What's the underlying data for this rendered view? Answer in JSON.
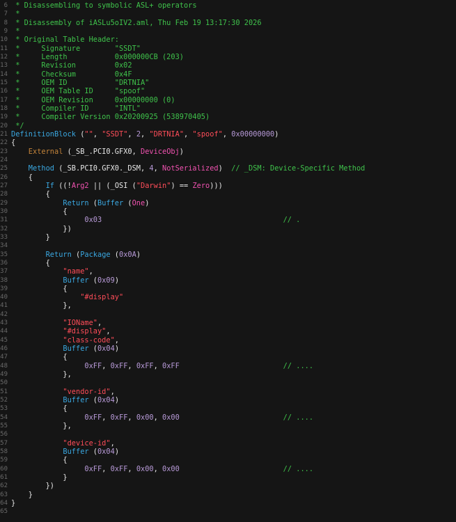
{
  "editor": {
    "colors": {
      "background": "#151515",
      "line_number": "#6a6a6a",
      "comment": "#3fc24b",
      "text": "#e8e8e8",
      "string": "#ff4d59",
      "keyword": "#3aa7e0",
      "number": "#b89ad8",
      "constant": "#f052b0",
      "external": "#c4843a"
    },
    "lines": [
      {
        "n": "6",
        "tokens": [
          {
            "t": "c",
            "v": " * Disassembling to symbolic ASL+ operators"
          }
        ]
      },
      {
        "n": "7",
        "tokens": [
          {
            "t": "c",
            "v": " *"
          }
        ]
      },
      {
        "n": "8",
        "tokens": [
          {
            "t": "c",
            "v": " * Disassembly of iASLu5oIV2.aml, Thu Feb 19 13:17:30 2026"
          }
        ]
      },
      {
        "n": "9",
        "tokens": [
          {
            "t": "c",
            "v": " *"
          }
        ]
      },
      {
        "n": "10",
        "tokens": [
          {
            "t": "c",
            "v": " * Original Table Header:"
          }
        ]
      },
      {
        "n": "11",
        "tokens": [
          {
            "t": "c",
            "v": " *     Signature        \"SSDT\""
          }
        ]
      },
      {
        "n": "12",
        "tokens": [
          {
            "t": "c",
            "v": " *     Length           0x000000CB (203)"
          }
        ]
      },
      {
        "n": "13",
        "tokens": [
          {
            "t": "c",
            "v": " *     Revision         0x02"
          }
        ]
      },
      {
        "n": "14",
        "tokens": [
          {
            "t": "c",
            "v": " *     Checksum         0x4F"
          }
        ]
      },
      {
        "n": "15",
        "tokens": [
          {
            "t": "c",
            "v": " *     OEM ID           \"DRTNIA\""
          }
        ]
      },
      {
        "n": "16",
        "tokens": [
          {
            "t": "c",
            "v": " *     OEM Table ID     \"spoof\""
          }
        ]
      },
      {
        "n": "17",
        "tokens": [
          {
            "t": "c",
            "v": " *     OEM Revision     0x00000000 (0)"
          }
        ]
      },
      {
        "n": "18",
        "tokens": [
          {
            "t": "c",
            "v": " *     Compiler ID      \"INTL\""
          }
        ]
      },
      {
        "n": "19",
        "tokens": [
          {
            "t": "c",
            "v": " *     Compiler Version 0x20200925 (538970405)"
          }
        ]
      },
      {
        "n": "20",
        "tokens": [
          {
            "t": "c",
            "v": " */"
          }
        ]
      },
      {
        "n": "21",
        "tokens": [
          {
            "t": "k",
            "v": "DefinitionBlock"
          },
          {
            "t": "t",
            "v": " ("
          },
          {
            "t": "s",
            "v": "\"\""
          },
          {
            "t": "t",
            "v": ", "
          },
          {
            "t": "s",
            "v": "\"SSDT\""
          },
          {
            "t": "t",
            "v": ", "
          },
          {
            "t": "n",
            "v": "2"
          },
          {
            "t": "t",
            "v": ", "
          },
          {
            "t": "s",
            "v": "\"DRTNIA\""
          },
          {
            "t": "t",
            "v": ", "
          },
          {
            "t": "s",
            "v": "\"spoof\""
          },
          {
            "t": "t",
            "v": ", "
          },
          {
            "t": "n",
            "v": "0x00000000"
          },
          {
            "t": "t",
            "v": ")"
          }
        ]
      },
      {
        "n": "22",
        "tokens": [
          {
            "t": "t",
            "v": "{"
          }
        ]
      },
      {
        "n": "23",
        "tokens": [
          {
            "t": "a",
            "v": "    External"
          },
          {
            "t": "t",
            "v": " (_SB_.PCI0.GFX0, "
          },
          {
            "t": "m",
            "v": "DeviceObj"
          },
          {
            "t": "t",
            "v": ")"
          }
        ]
      },
      {
        "n": "24",
        "tokens": []
      },
      {
        "n": "25",
        "tokens": [
          {
            "t": "k",
            "v": "    Method"
          },
          {
            "t": "t",
            "v": " (_SB.PCI0.GFX0._DSM, "
          },
          {
            "t": "n",
            "v": "4"
          },
          {
            "t": "t",
            "v": ", "
          },
          {
            "t": "m",
            "v": "NotSerialized"
          },
          {
            "t": "t",
            "v": ")  "
          },
          {
            "t": "c",
            "v": "// _DSM: Device-Specific Method"
          }
        ]
      },
      {
        "n": "26",
        "tokens": [
          {
            "t": "t",
            "v": "    {"
          }
        ]
      },
      {
        "n": "27",
        "tokens": [
          {
            "t": "k",
            "v": "        If"
          },
          {
            "t": "t",
            "v": " ((!"
          },
          {
            "t": "m",
            "v": "Arg2"
          },
          {
            "t": "t",
            "v": " || (_OSI ("
          },
          {
            "t": "s",
            "v": "\"Darwin\""
          },
          {
            "t": "t",
            "v": ") == "
          },
          {
            "t": "m",
            "v": "Zero"
          },
          {
            "t": "t",
            "v": ")))"
          }
        ]
      },
      {
        "n": "28",
        "tokens": [
          {
            "t": "t",
            "v": "        {"
          }
        ]
      },
      {
        "n": "29",
        "tokens": [
          {
            "t": "k",
            "v": "            Return"
          },
          {
            "t": "t",
            "v": " ("
          },
          {
            "t": "k",
            "v": "Buffer"
          },
          {
            "t": "t",
            "v": " ("
          },
          {
            "t": "m",
            "v": "One"
          },
          {
            "t": "t",
            "v": ")"
          }
        ]
      },
      {
        "n": "30",
        "tokens": [
          {
            "t": "t",
            "v": "            {"
          }
        ]
      },
      {
        "n": "31",
        "tokens": [
          {
            "t": "n",
            "v": "                 0x03"
          },
          {
            "t": "t",
            "v": "                                          "
          },
          {
            "t": "c",
            "v": "// ."
          }
        ]
      },
      {
        "n": "32",
        "tokens": [
          {
            "t": "t",
            "v": "            })"
          }
        ]
      },
      {
        "n": "33",
        "tokens": [
          {
            "t": "t",
            "v": "        }"
          }
        ]
      },
      {
        "n": "34",
        "tokens": []
      },
      {
        "n": "35",
        "tokens": [
          {
            "t": "k",
            "v": "        Return"
          },
          {
            "t": "t",
            "v": " ("
          },
          {
            "t": "k",
            "v": "Package"
          },
          {
            "t": "t",
            "v": " ("
          },
          {
            "t": "n",
            "v": "0x0A"
          },
          {
            "t": "t",
            "v": ")"
          }
        ]
      },
      {
        "n": "36",
        "tokens": [
          {
            "t": "t",
            "v": "        {"
          }
        ]
      },
      {
        "n": "37",
        "tokens": [
          {
            "t": "s",
            "v": "            \"name\""
          },
          {
            "t": "t",
            "v": ","
          }
        ]
      },
      {
        "n": "38",
        "tokens": [
          {
            "t": "k",
            "v": "            Buffer"
          },
          {
            "t": "t",
            "v": " ("
          },
          {
            "t": "n",
            "v": "0x09"
          },
          {
            "t": "t",
            "v": ")"
          }
        ]
      },
      {
        "n": "39",
        "tokens": [
          {
            "t": "t",
            "v": "            {"
          }
        ]
      },
      {
        "n": "40",
        "tokens": [
          {
            "t": "s",
            "v": "                \"#display\""
          }
        ]
      },
      {
        "n": "41",
        "tokens": [
          {
            "t": "t",
            "v": "            },"
          }
        ]
      },
      {
        "n": "42",
        "tokens": []
      },
      {
        "n": "43",
        "tokens": [
          {
            "t": "s",
            "v": "            \"IOName\""
          },
          {
            "t": "t",
            "v": ","
          }
        ]
      },
      {
        "n": "44",
        "tokens": [
          {
            "t": "s",
            "v": "            \"#display\""
          },
          {
            "t": "t",
            "v": ","
          }
        ]
      },
      {
        "n": "45",
        "tokens": [
          {
            "t": "s",
            "v": "            \"class-code\""
          },
          {
            "t": "t",
            "v": ","
          }
        ]
      },
      {
        "n": "46",
        "tokens": [
          {
            "t": "k",
            "v": "            Buffer"
          },
          {
            "t": "t",
            "v": " ("
          },
          {
            "t": "n",
            "v": "0x04"
          },
          {
            "t": "t",
            "v": ")"
          }
        ]
      },
      {
        "n": "47",
        "tokens": [
          {
            "t": "t",
            "v": "            {"
          }
        ]
      },
      {
        "n": "48",
        "tokens": [
          {
            "t": "n",
            "v": "                 0xFF"
          },
          {
            "t": "t",
            "v": ", "
          },
          {
            "t": "n",
            "v": "0xFF"
          },
          {
            "t": "t",
            "v": ", "
          },
          {
            "t": "n",
            "v": "0xFF"
          },
          {
            "t": "t",
            "v": ", "
          },
          {
            "t": "n",
            "v": "0xFF"
          },
          {
            "t": "t",
            "v": "                        "
          },
          {
            "t": "c",
            "v": "// ...."
          }
        ]
      },
      {
        "n": "49",
        "tokens": [
          {
            "t": "t",
            "v": "            },"
          }
        ]
      },
      {
        "n": "50",
        "tokens": []
      },
      {
        "n": "51",
        "tokens": [
          {
            "t": "s",
            "v": "            \"vendor-id\""
          },
          {
            "t": "t",
            "v": ","
          }
        ]
      },
      {
        "n": "52",
        "tokens": [
          {
            "t": "k",
            "v": "            Buffer"
          },
          {
            "t": "t",
            "v": " ("
          },
          {
            "t": "n",
            "v": "0x04"
          },
          {
            "t": "t",
            "v": ")"
          }
        ]
      },
      {
        "n": "53",
        "tokens": [
          {
            "t": "t",
            "v": "            {"
          }
        ]
      },
      {
        "n": "54",
        "tokens": [
          {
            "t": "n",
            "v": "                 0xFF"
          },
          {
            "t": "t",
            "v": ", "
          },
          {
            "t": "n",
            "v": "0xFF"
          },
          {
            "t": "t",
            "v": ", "
          },
          {
            "t": "n",
            "v": "0x00"
          },
          {
            "t": "t",
            "v": ", "
          },
          {
            "t": "n",
            "v": "0x00"
          },
          {
            "t": "t",
            "v": "                        "
          },
          {
            "t": "c",
            "v": "// ...."
          }
        ]
      },
      {
        "n": "55",
        "tokens": [
          {
            "t": "t",
            "v": "            },"
          }
        ]
      },
      {
        "n": "56",
        "tokens": []
      },
      {
        "n": "57",
        "tokens": [
          {
            "t": "s",
            "v": "            \"device-id\""
          },
          {
            "t": "t",
            "v": ","
          }
        ]
      },
      {
        "n": "58",
        "tokens": [
          {
            "t": "k",
            "v": "            Buffer"
          },
          {
            "t": "t",
            "v": " ("
          },
          {
            "t": "n",
            "v": "0x04"
          },
          {
            "t": "t",
            "v": ")"
          }
        ]
      },
      {
        "n": "59",
        "tokens": [
          {
            "t": "t",
            "v": "            {"
          }
        ]
      },
      {
        "n": "60",
        "tokens": [
          {
            "t": "n",
            "v": "                 0xFF"
          },
          {
            "t": "t",
            "v": ", "
          },
          {
            "t": "n",
            "v": "0xFF"
          },
          {
            "t": "t",
            "v": ", "
          },
          {
            "t": "n",
            "v": "0x00"
          },
          {
            "t": "t",
            "v": ", "
          },
          {
            "t": "n",
            "v": "0x00"
          },
          {
            "t": "t",
            "v": "                        "
          },
          {
            "t": "c",
            "v": "// ...."
          }
        ]
      },
      {
        "n": "61",
        "tokens": [
          {
            "t": "t",
            "v": "            }"
          }
        ]
      },
      {
        "n": "62",
        "tokens": [
          {
            "t": "t",
            "v": "        })"
          }
        ]
      },
      {
        "n": "63",
        "tokens": [
          {
            "t": "t",
            "v": "    }"
          }
        ]
      },
      {
        "n": "64",
        "tokens": [
          {
            "t": "t",
            "v": "}"
          }
        ]
      },
      {
        "n": "65",
        "tokens": []
      }
    ]
  }
}
